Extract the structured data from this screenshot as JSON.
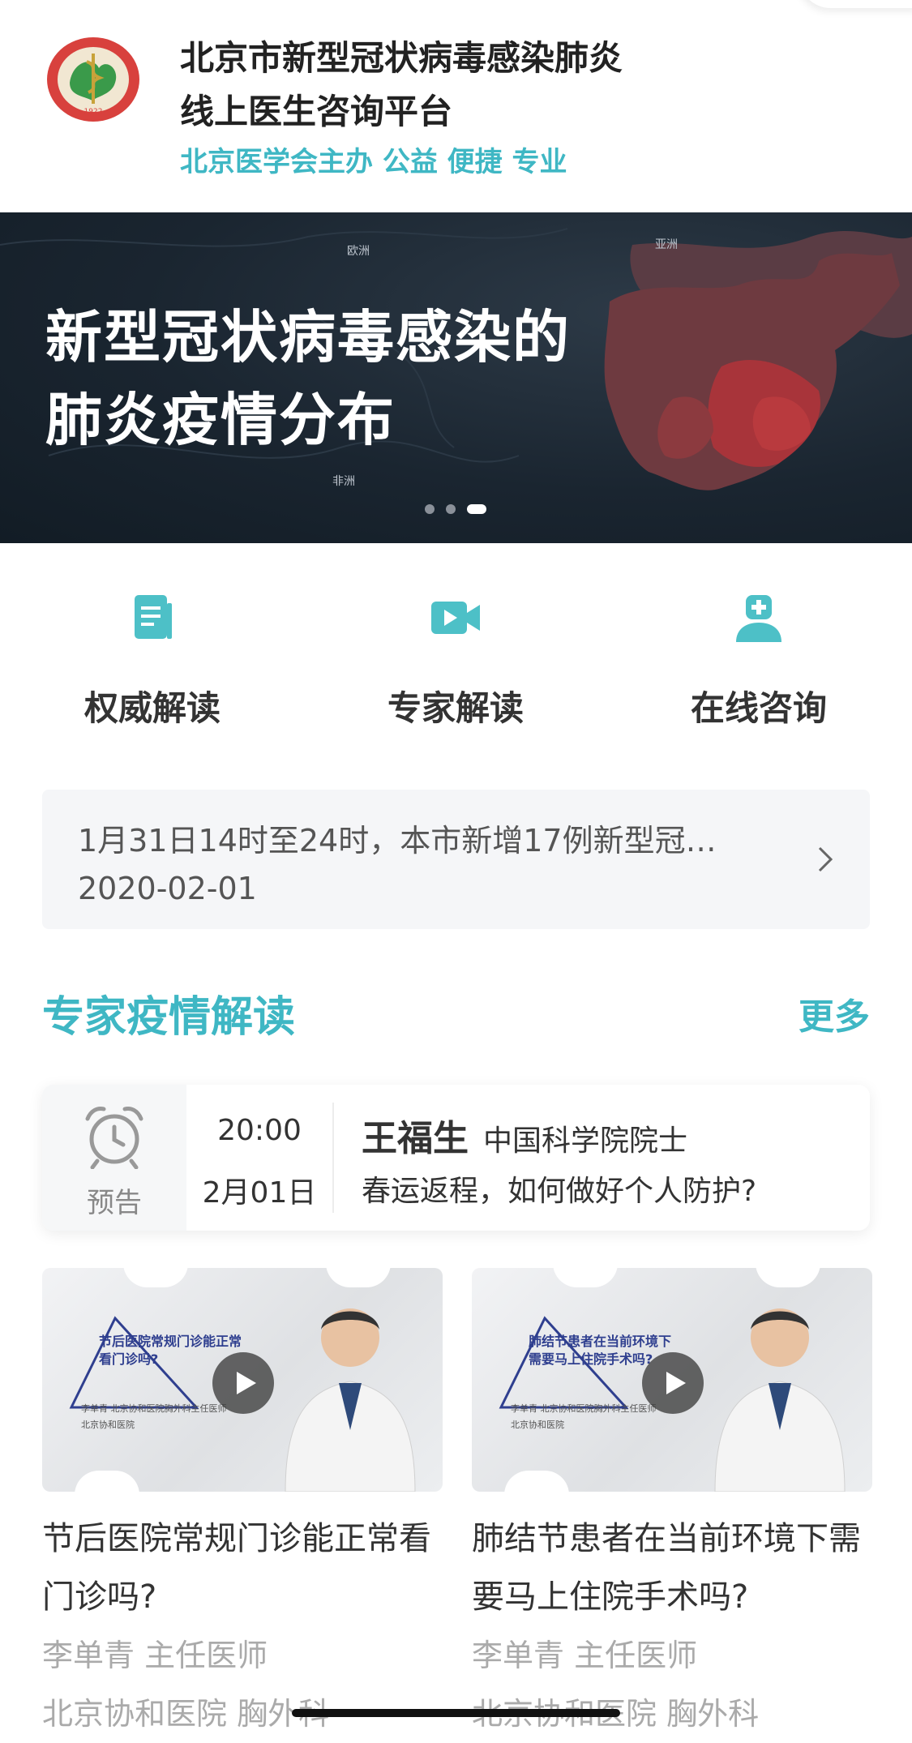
{
  "header": {
    "title_line1": "北京市新型冠状病毒感染肺炎",
    "title_line2": "线上医生咨询平台",
    "subtitle": "北京医学会主办 公益 便捷 专业",
    "logo_year": "1922"
  },
  "banner": {
    "title_line1": "新型冠状病毒感染的",
    "title_line2": "肺炎疫情分布",
    "map_labels": [
      "亚洲",
      "欧洲",
      "非洲"
    ],
    "slides": 3,
    "active_slide": 3
  },
  "nav": [
    {
      "label": "权威解读",
      "icon": "document-icon"
    },
    {
      "label": "专家解读",
      "icon": "video-camera-icon"
    },
    {
      "label": "在线咨询",
      "icon": "doctor-icon"
    }
  ],
  "notice": {
    "text": "1月31日14时至24时，本市新增17例新型冠…",
    "date": "2020-02-01"
  },
  "section": {
    "title": "专家疫情解读",
    "more": "更多"
  },
  "live": {
    "tag": "预告",
    "time": "20:00",
    "day": "2月01日",
    "name": "王福生",
    "org": "中国科学院院士",
    "topic": "春运返程，如何做好个人防护?"
  },
  "videos": [
    {
      "thumb_caption": "节后医院常规门诊能正常看门诊吗?",
      "thumb_doctor": "李单青",
      "thumb_doctor_title": "北京协和医院胸外科主任医师",
      "thumb_hospital": "北京协和医院",
      "title": "节后医院常规门诊能正常看门诊吗?",
      "doctor": "李单青",
      "position": "主任医师",
      "hospital": "北京协和医院",
      "dept": "胸外科"
    },
    {
      "thumb_caption": "肺结节患者在当前环境下需要马上住院手术吗?",
      "thumb_doctor": "李单青",
      "thumb_doctor_title": "北京协和医院胸外科主任医师",
      "thumb_hospital": "北京协和医院",
      "title": "肺结节患者在当前环境下需要马上住院手术吗?",
      "doctor": "李单青",
      "position": "主任医师",
      "hospital": "北京协和医院",
      "dept": "胸外科"
    }
  ],
  "colors": {
    "accent": "#3fb7c4",
    "banner_bg": "#1a2530",
    "map_red": "#a8343a"
  }
}
